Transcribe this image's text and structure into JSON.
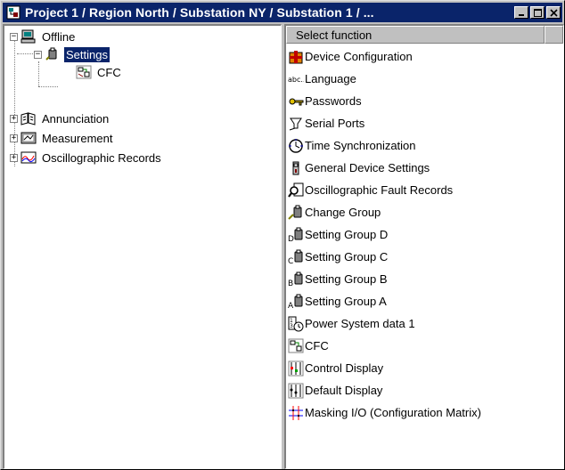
{
  "window": {
    "title": "Project 1 / Region North / Substation NY / Substation 1 / ...",
    "controls": [
      "minimize",
      "maximize",
      "close"
    ]
  },
  "tree": {
    "root": {
      "label": "Offline",
      "icon": "computer-icon",
      "expanded": true
    },
    "items": [
      {
        "label": "Settings",
        "icon": "settings-icon",
        "level": 1,
        "expanded": true,
        "selected": true
      },
      {
        "label": "CFC",
        "icon": "cfc-icon",
        "level": 2
      },
      {
        "label": "Annunciation",
        "icon": "annunciation-icon",
        "level": 1,
        "expanded": false
      },
      {
        "label": "Measurement",
        "icon": "measurement-icon",
        "level": 1,
        "expanded": false
      },
      {
        "label": "Oscillographic Records",
        "icon": "oscillographic-records-icon",
        "level": 1,
        "expanded": false
      }
    ]
  },
  "functions": {
    "header": "Select function",
    "items": [
      {
        "label": "Device Configuration",
        "icon": "device-configuration-icon"
      },
      {
        "label": "Language",
        "icon": "language-icon"
      },
      {
        "label": "Passwords",
        "icon": "key-icon"
      },
      {
        "label": "Serial Ports",
        "icon": "serial-port-icon"
      },
      {
        "label": "Time Synchronization",
        "icon": "clock-icon"
      },
      {
        "label": "General Device Settings",
        "icon": "device-icon"
      },
      {
        "label": "Oscillographic Fault Records",
        "icon": "magnifier-icon"
      },
      {
        "label": "Change Group",
        "icon": "change-group-icon"
      },
      {
        "label": "Setting Group D",
        "icon": "setting-group-d-icon"
      },
      {
        "label": "Setting Group C",
        "icon": "setting-group-c-icon"
      },
      {
        "label": "Setting Group B",
        "icon": "setting-group-b-icon"
      },
      {
        "label": "Setting Group A",
        "icon": "setting-group-a-icon"
      },
      {
        "label": "Power System data 1",
        "icon": "power-system-icon"
      },
      {
        "label": "CFC",
        "icon": "cfc-icon"
      },
      {
        "label": "Control Display",
        "icon": "control-display-icon"
      },
      {
        "label": "Default Display",
        "icon": "default-display-icon"
      },
      {
        "label": "Masking I/O (Configuration Matrix)",
        "icon": "matrix-icon"
      }
    ]
  },
  "colors": {
    "titlebar": "#0a246a",
    "selection": "#0a246a",
    "window_bg": "#c0c0c0"
  }
}
